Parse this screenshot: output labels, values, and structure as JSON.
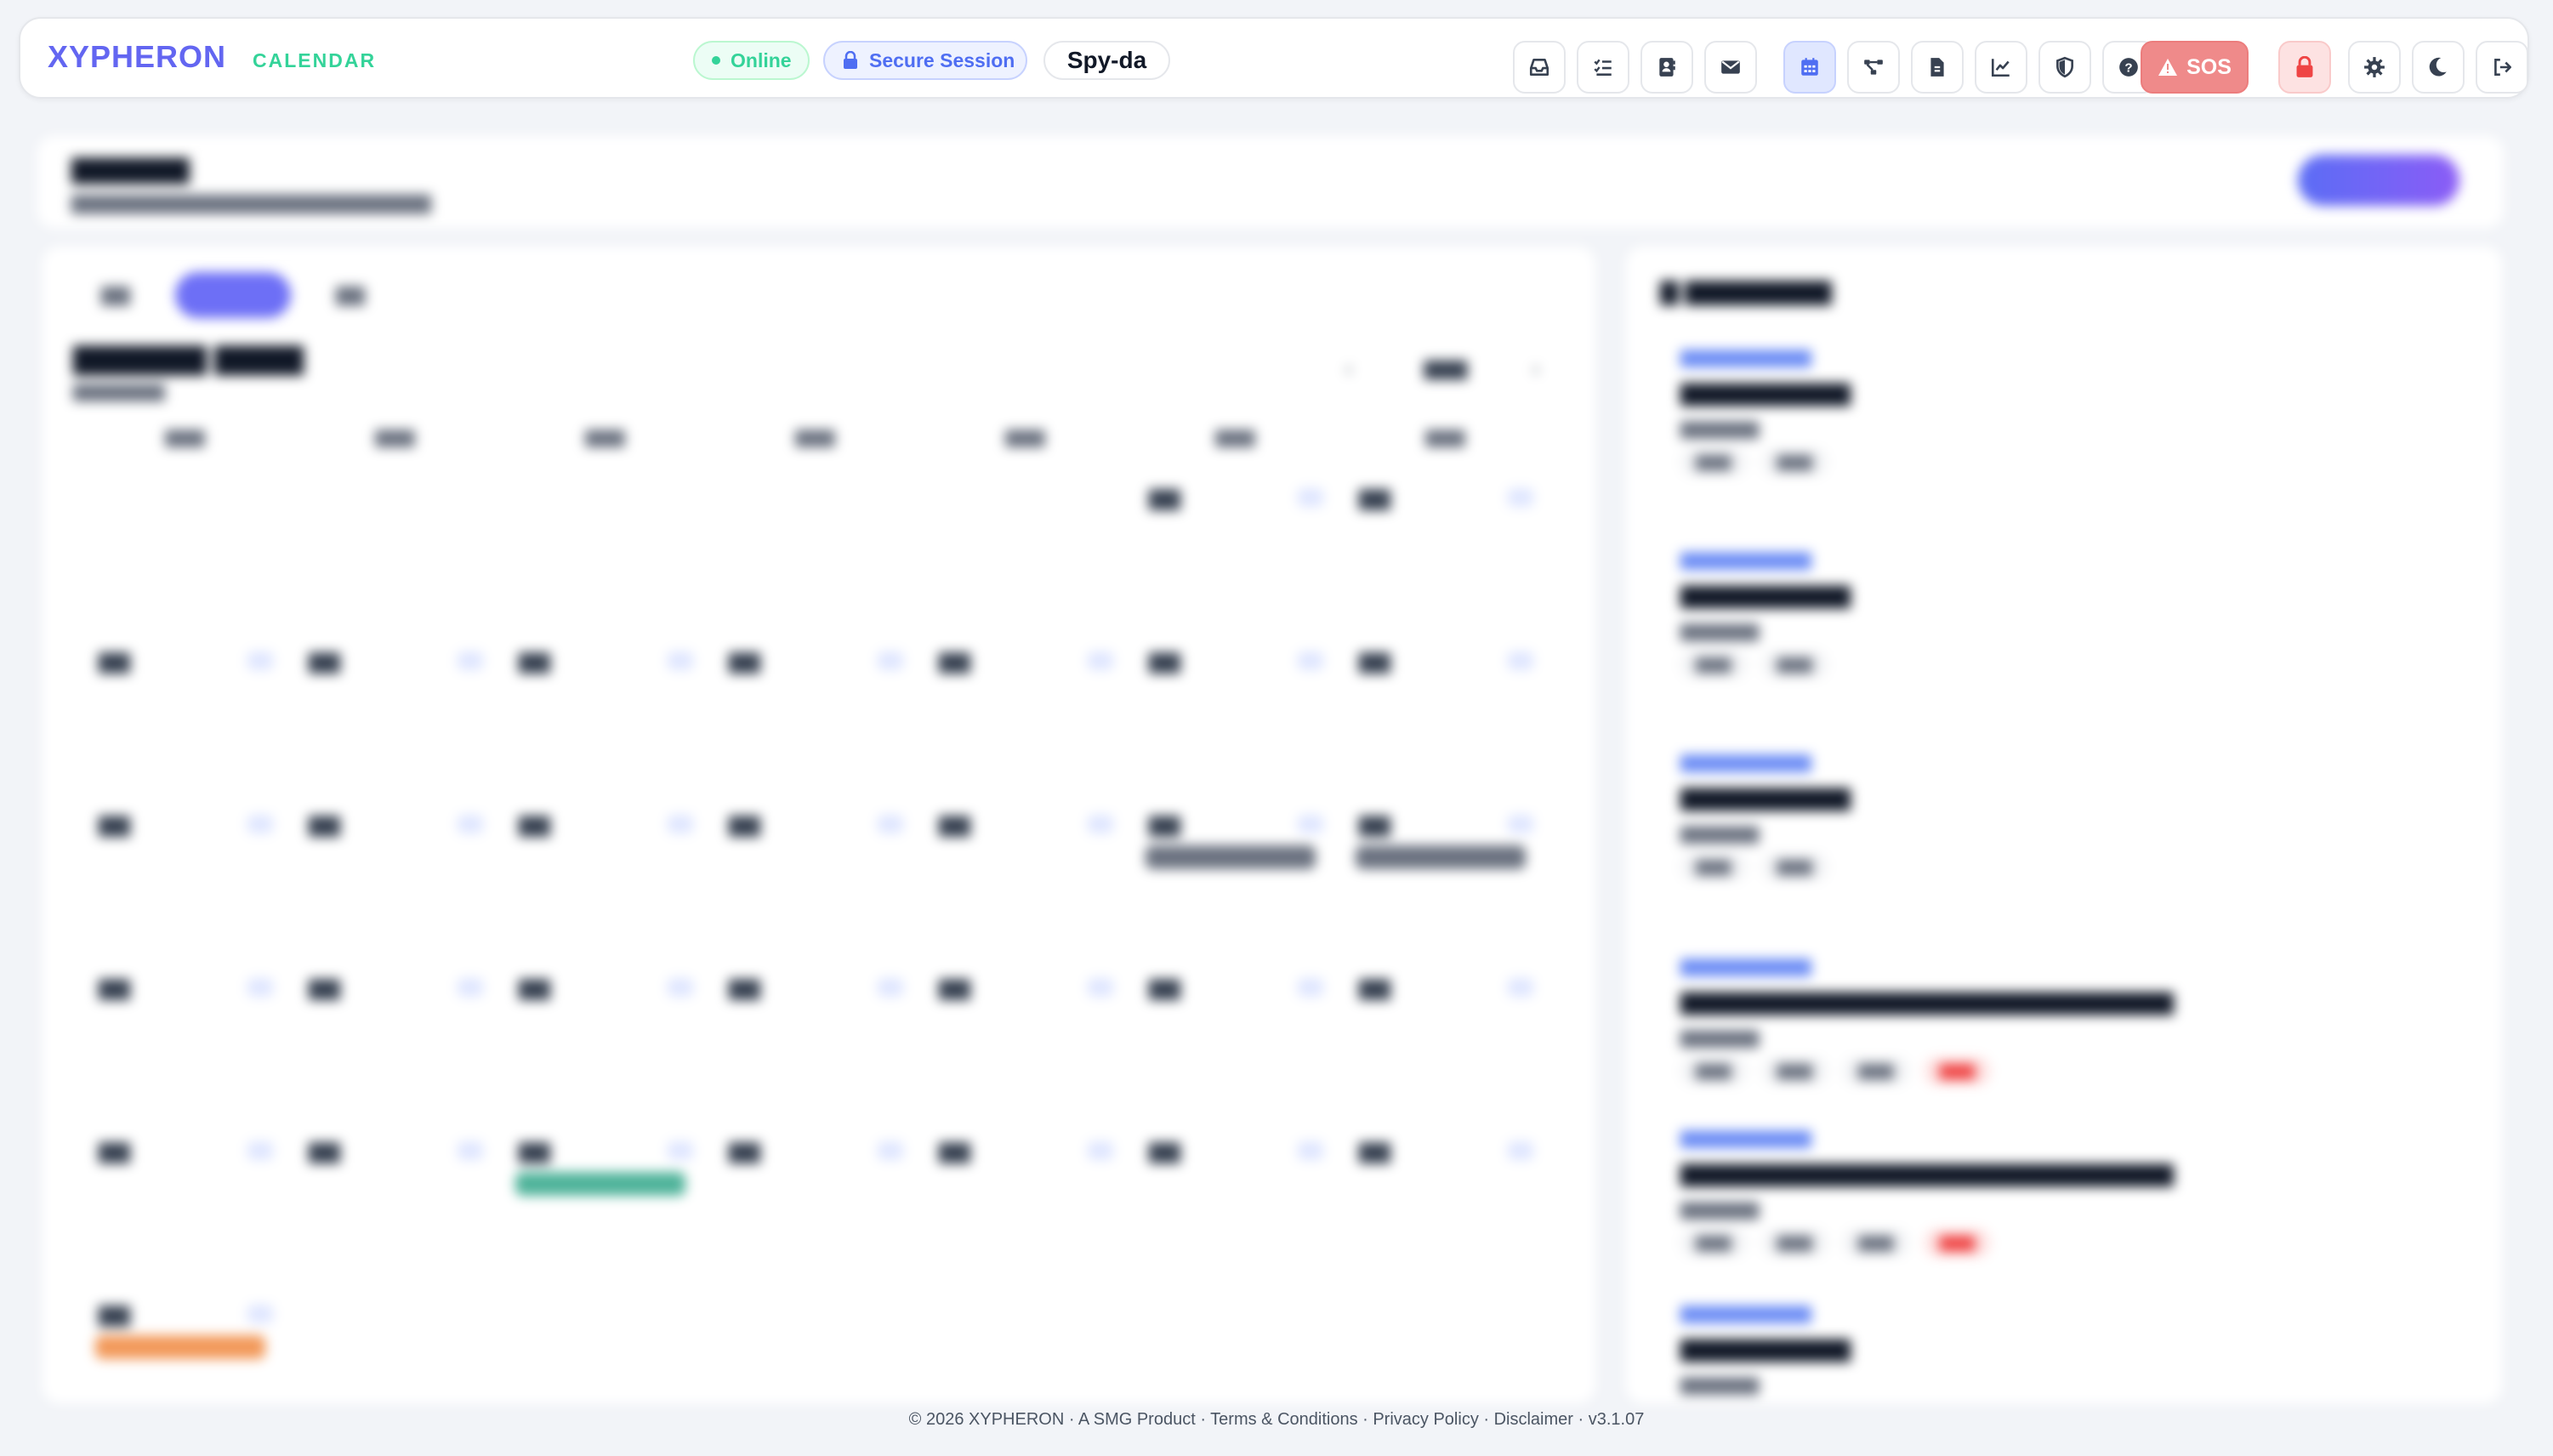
{
  "app": {
    "brand": "XYPHERON",
    "section": "CALENDAR"
  },
  "status": {
    "online": "Online",
    "secure": "Secure Session",
    "user": "Spy-da"
  },
  "toolbar": {
    "icons": [
      "inbox-icon",
      "checklist-icon",
      "contacts-icon",
      "mail-icon",
      "calendar-icon",
      "network-icon",
      "document-icon",
      "chart-icon",
      "shield-icon",
      "help-icon",
      "sos-icon",
      "lock-icon",
      "gear-icon",
      "moon-icon",
      "logout-icon"
    ],
    "active": "calendar-icon",
    "sos_label": "SOS"
  },
  "colors": {
    "brand": "#6366f1",
    "section": "#34d399",
    "online": "#34d399",
    "secure": "#4f6ef2",
    "sos": "#ef8a8a",
    "lock": "#ef4444",
    "event_slate": "#6b7280",
    "event_teal": "#4fb39a",
    "event_orange": "#f2995a"
  },
  "footer": {
    "text": "© 2026 XYPHERON · A SMG Product · Terms & Conditions · Privacy Policy · Disclaimer · v3.1.07"
  }
}
